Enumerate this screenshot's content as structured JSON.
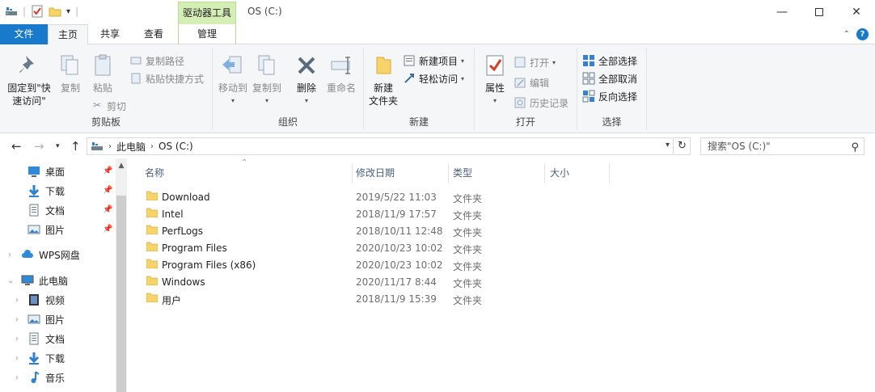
{
  "window": {
    "title": "OS (C:)",
    "context_tab_group": "驱动器工具"
  },
  "tabs": {
    "file": "文件",
    "home": "主页",
    "share": "共享",
    "view": "查看",
    "manage": "管理"
  },
  "ribbon": {
    "clipboard": {
      "label": "剪贴板",
      "pin_quick_access": "固定到\"快",
      "pin_quick_access_2": "速访问\"",
      "copy": "复制",
      "paste": "粘贴",
      "copy_path": "复制路径",
      "paste_shortcut": "粘贴快捷方式",
      "cut": "剪切"
    },
    "organize": {
      "label": "组织",
      "move_to": "移动到",
      "copy_to": "复制到",
      "delete": "删除",
      "rename": "重命名"
    },
    "new": {
      "label": "新建",
      "new_folder_1": "新建",
      "new_folder_2": "文件夹",
      "new_item": "新建项目",
      "easy_access": "轻松访问"
    },
    "open": {
      "label": "打开",
      "properties": "属性",
      "open": "打开",
      "edit": "编辑",
      "history": "历史记录"
    },
    "select": {
      "label": "选择",
      "select_all": "全部选择",
      "select_none": "全部取消",
      "invert": "反向选择"
    }
  },
  "address": {
    "segments": [
      "此电脑",
      "OS (C:)"
    ],
    "search_placeholder": "搜索\"OS (C:)\""
  },
  "nav": {
    "quick": [
      {
        "label": "桌面"
      },
      {
        "label": "下载"
      },
      {
        "label": "文档"
      },
      {
        "label": "图片"
      }
    ],
    "wps": "WPS网盘",
    "this_pc": "此电脑",
    "pc_items": [
      {
        "label": "视频"
      },
      {
        "label": "图片"
      },
      {
        "label": "文档"
      },
      {
        "label": "下载"
      },
      {
        "label": "音乐"
      }
    ]
  },
  "columns": {
    "name": "名称",
    "modified": "修改日期",
    "type": "类型",
    "size": "大小"
  },
  "files": [
    {
      "name": "Download",
      "modified": "2019/5/22 11:03",
      "type": "文件夹"
    },
    {
      "name": "Intel",
      "modified": "2018/11/9 17:57",
      "type": "文件夹"
    },
    {
      "name": "PerfLogs",
      "modified": "2018/10/11 12:48",
      "type": "文件夹"
    },
    {
      "name": "Program Files",
      "modified": "2020/10/23 10:02",
      "type": "文件夹"
    },
    {
      "name": "Program Files (x86)",
      "modified": "2020/10/23 10:02",
      "type": "文件夹"
    },
    {
      "name": "Windows",
      "modified": "2020/11/17 8:44",
      "type": "文件夹"
    },
    {
      "name": "用户",
      "modified": "2018/11/9 15:39",
      "type": "文件夹"
    }
  ],
  "colors": {
    "accent": "#1979ca",
    "context_tab": "#d4eeb6",
    "folder": "#f7d36a"
  }
}
